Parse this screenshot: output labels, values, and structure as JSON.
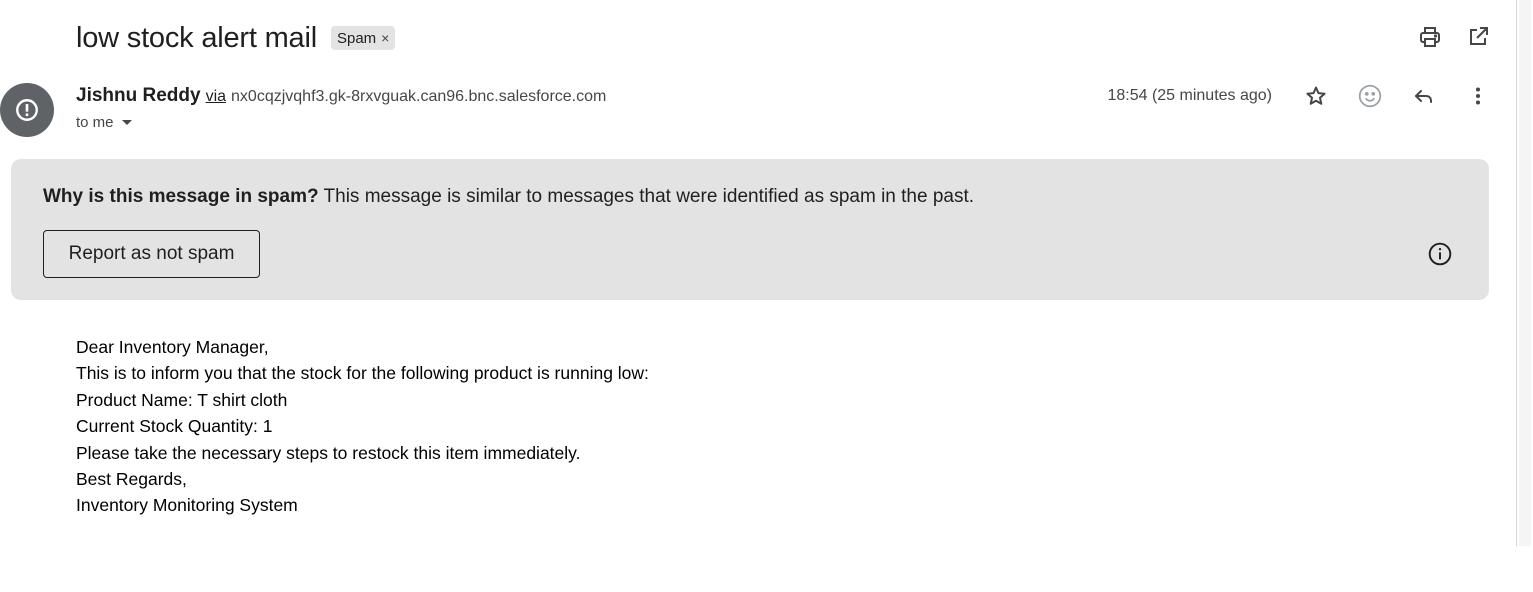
{
  "subject": "low stock alert mail",
  "label_chip": {
    "text": "Spam",
    "remove_glyph": "×"
  },
  "top_actions": {
    "print_icon": "print-icon",
    "open_new_window_icon": "open-in-new-icon"
  },
  "sender": {
    "name": "Jishnu Reddy",
    "via_label": "via",
    "via_domain": "nx0cqzjvqhf3.gk-8rxvguak.can96.bnc.salesforce.com",
    "recipient": "to me",
    "avatar_icon": "spam-warning-icon",
    "avatar_color": "#5f6368"
  },
  "timestamp": "18:54 (25 minutes ago)",
  "message_actions": {
    "star_icon": "star-icon",
    "emoji_icon": "emoji-reaction-icon",
    "reply_icon": "reply-icon",
    "more_icon": "more-vert-icon"
  },
  "spam_banner": {
    "question": "Why is this message in spam?",
    "explanation": " This message is similar to messages that were identified as spam in the past.",
    "button_label": "Report as not spam",
    "info_icon": "info-icon",
    "background": "#e3e3e3"
  },
  "body_lines": [
    "Dear Inventory Manager,",
    "This is to inform you that the stock for the following product is running low:",
    "Product Name: T shirt cloth",
    "Current Stock Quantity: 1",
    "Please take the necessary steps to restock this item immediately.",
    "Best Regards,",
    "Inventory Monitoring System"
  ]
}
